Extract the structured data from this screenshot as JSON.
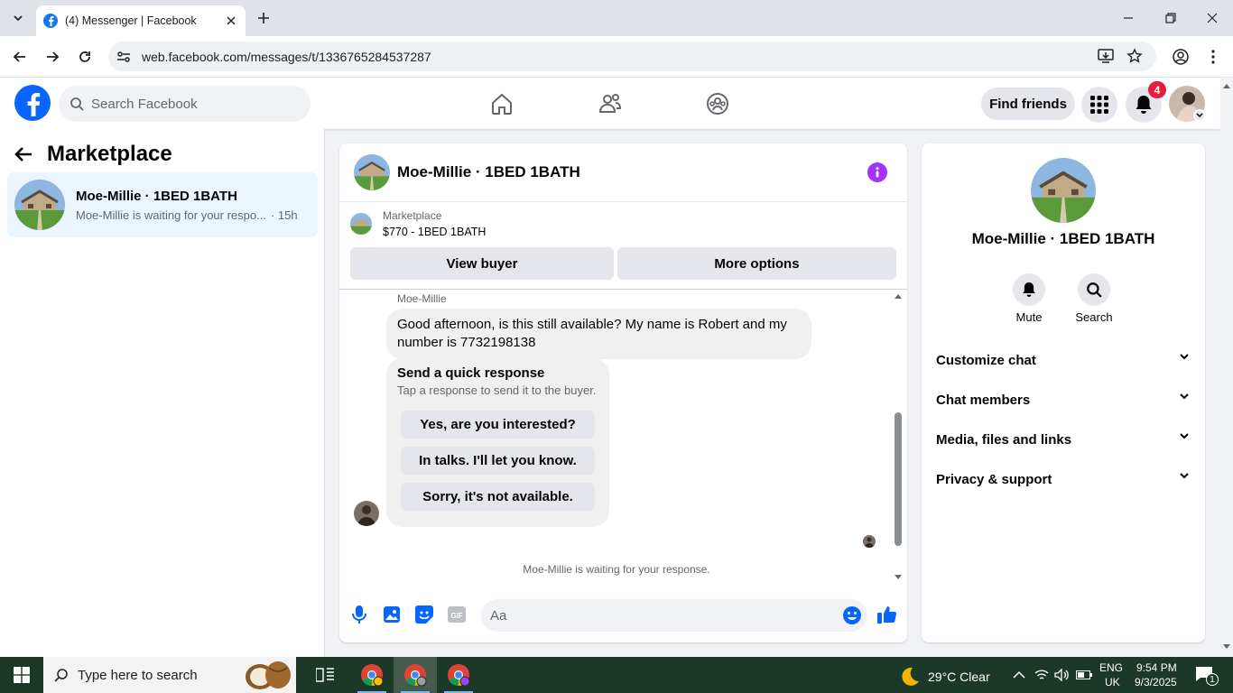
{
  "browser": {
    "tab_title": "(4) Messenger | Facebook",
    "url": "web.facebook.com/messages/t/1336765284537287"
  },
  "facebook": {
    "search_placeholder": "Search Facebook",
    "find_friends": "Find friends",
    "notification_count": "4"
  },
  "left_panel": {
    "title": "Marketplace",
    "conversations": [
      {
        "name": "Moe-Millie · 1BED 1BATH",
        "preview": "Moe-Millie is waiting for your respo...",
        "time": "· 15h"
      }
    ]
  },
  "chat": {
    "title": "Moe-Millie · 1BED 1BATH",
    "marketplace_label": "Marketplace",
    "listing": "$770 - 1BED 1BATH",
    "view_buyer": "View buyer",
    "more_options": "More options",
    "sender_name": "Moe-Millie",
    "message": "Good afternoon, is this still available? My name is Robert and my number is 7732198138",
    "quick_response": {
      "heading": "Send a quick response",
      "subtext": "Tap a response to send it to the buyer.",
      "options": [
        "Yes, are you interested?",
        "In talks. I'll let you know.",
        "Sorry, it's not available."
      ]
    },
    "waiting_text": "Moe-Millie is waiting for your response.",
    "input_placeholder": "Aa"
  },
  "details": {
    "name": "Moe-Millie · 1BED 1BATH",
    "actions": [
      "Mute",
      "Search"
    ],
    "sections": [
      "Customize chat",
      "Chat members",
      "Media, files and links",
      "Privacy & support"
    ]
  },
  "taskbar": {
    "search_placeholder": "Type here to search",
    "weather": "29°C  Clear",
    "lang1": "ENG",
    "lang2": "UK",
    "time": "9:54 PM",
    "date": "9/3/2025",
    "notif_count": "1"
  },
  "colors": {
    "fb_blue": "#0866ff",
    "messenger_purple": "#a033ff",
    "selected_conv_bg": "#ebf5ff",
    "taskbar_bg": "#1c3828"
  }
}
